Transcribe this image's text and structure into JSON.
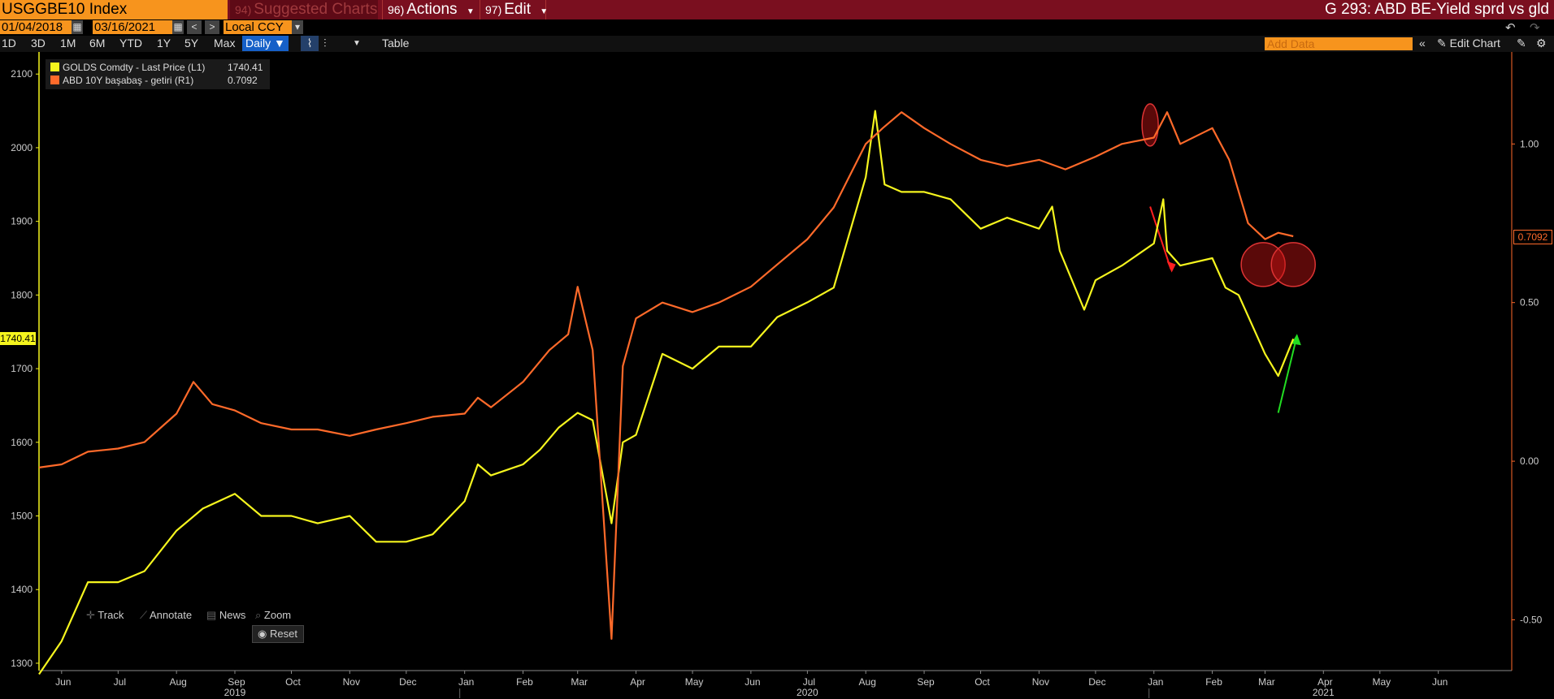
{
  "header": {
    "ticker": "USGGBE10 Index",
    "suggested_num": "94)",
    "suggested_label": "Suggested Charts",
    "actions_num": "96)",
    "actions_label": "Actions",
    "edit_num": "97)",
    "edit_label": "Edit",
    "chart_name": "G 293: ABD BE-Yield sprd vs gld"
  },
  "date_range": {
    "start": "01/04/2018",
    "end": "03/16/2021",
    "currency": "Local CCY"
  },
  "range_buttons": [
    "1D",
    "3D",
    "1M",
    "6M",
    "YTD",
    "1Y",
    "5Y",
    "Max"
  ],
  "frequency": "Daily ▼",
  "table_label": "Table",
  "add_data_placeholder": "Add Data",
  "edit_chart_label": "Edit Chart",
  "legend": [
    {
      "name": "GOLDS Comdty - Last Price (L1)",
      "value": "1740.41",
      "color": "#f5f51e"
    },
    {
      "name": "ABD 10Y başabaş - getiri (R1)",
      "value": "0.7092",
      "color": "#ff6a2a"
    }
  ],
  "tools": {
    "track": "Track",
    "annotate": "Annotate",
    "news": "News",
    "zoom": "Zoom",
    "reset": "Reset"
  },
  "current_labels": {
    "left": "1740.41",
    "right": "0.7092"
  },
  "icons": [
    "calendar-icon",
    "prev-icon",
    "next-icon",
    "dropdown-icon",
    "line-chart-icon",
    "candle-icon",
    "undo-icon",
    "redo-icon",
    "collapse-icon",
    "pencil-icon",
    "settings-icon",
    "track-icon",
    "annotate-icon",
    "news-icon",
    "zoom-icon",
    "radio-icon"
  ],
  "chart_data": {
    "type": "line",
    "x_range": [
      "2019-05-20",
      "2021-07-10"
    ],
    "left_axis": {
      "ylim": [
        1290,
        2130
      ],
      "ticks": [
        1300,
        1400,
        1500,
        1600,
        1700,
        1800,
        1900,
        2000,
        2100
      ]
    },
    "right_axis": {
      "ylim": [
        -0.66,
        1.29
      ],
      "ticks": [
        -0.5,
        0.0,
        0.5,
        1.0
      ],
      "tick_labels": [
        "-0.50",
        "0.00",
        "0.50",
        "1.00"
      ]
    },
    "x_ticks": [
      "Jun",
      "Jul",
      "Aug",
      "Sep",
      "Oct",
      "Nov",
      "Dec",
      "Jan",
      "Feb",
      "Mar",
      "Apr",
      "May",
      "Jun",
      "Jul",
      "Aug",
      "Sep",
      "Oct",
      "Nov",
      "Dec",
      "Jan",
      "Feb",
      "Mar",
      "Apr",
      "May",
      "Jun"
    ],
    "x_tick_dates": [
      "2019-06-01",
      "2019-07-01",
      "2019-08-01",
      "2019-09-01",
      "2019-10-01",
      "2019-11-01",
      "2019-12-01",
      "2020-01-01",
      "2020-02-01",
      "2020-03-01",
      "2020-04-01",
      "2020-05-01",
      "2020-06-01",
      "2020-07-01",
      "2020-08-01",
      "2020-09-01",
      "2020-10-01",
      "2020-11-01",
      "2020-12-01",
      "2021-01-01",
      "2021-02-01",
      "2021-03-01",
      "2021-04-01",
      "2021-05-01",
      "2021-06-01"
    ],
    "year_labels": [
      {
        "label": "2019",
        "date": "2019-09-01"
      },
      {
        "label": "2020",
        "date": "2020-07-01"
      },
      {
        "label": "2021",
        "date": "2021-04-01"
      }
    ],
    "series": [
      {
        "name": "GOLDS Comdty - Last Price (L1)",
        "axis": "left",
        "color": "#f5f51e",
        "x": [
          "2019-05-20",
          "2019-06-01",
          "2019-06-15",
          "2019-07-01",
          "2019-07-15",
          "2019-08-01",
          "2019-08-15",
          "2019-09-01",
          "2019-09-15",
          "2019-10-01",
          "2019-10-15",
          "2019-11-01",
          "2019-11-15",
          "2019-12-01",
          "2019-12-15",
          "2020-01-01",
          "2020-01-08",
          "2020-01-15",
          "2020-02-01",
          "2020-02-10",
          "2020-02-20",
          "2020-03-01",
          "2020-03-09",
          "2020-03-19",
          "2020-03-25",
          "2020-04-01",
          "2020-04-15",
          "2020-05-01",
          "2020-05-15",
          "2020-06-01",
          "2020-06-15",
          "2020-07-01",
          "2020-07-15",
          "2020-08-01",
          "2020-08-06",
          "2020-08-11",
          "2020-08-20",
          "2020-09-01",
          "2020-09-15",
          "2020-10-01",
          "2020-10-15",
          "2020-11-01",
          "2020-11-08",
          "2020-11-12",
          "2020-11-25",
          "2020-12-01",
          "2020-12-15",
          "2021-01-01",
          "2021-01-06",
          "2021-01-08",
          "2021-01-15",
          "2021-02-01",
          "2021-02-08",
          "2021-02-15",
          "2021-03-01",
          "2021-03-08",
          "2021-03-16"
        ],
        "values": [
          1285,
          1330,
          1410,
          1410,
          1425,
          1480,
          1510,
          1530,
          1500,
          1500,
          1490,
          1500,
          1465,
          1465,
          1475,
          1520,
          1570,
          1555,
          1570,
          1590,
          1620,
          1640,
          1630,
          1490,
          1600,
          1610,
          1720,
          1700,
          1730,
          1730,
          1770,
          1790,
          1810,
          1960,
          2050,
          1950,
          1940,
          1940,
          1930,
          1890,
          1905,
          1890,
          1920,
          1860,
          1780,
          1820,
          1840,
          1870,
          1930,
          1860,
          1840,
          1850,
          1810,
          1800,
          1720,
          1690,
          1740.41
        ]
      },
      {
        "name": "ABD 10Y başabaş - getiri (R1)",
        "axis": "right",
        "color": "#ff6a2a",
        "x": [
          "2019-05-20",
          "2019-06-01",
          "2019-06-15",
          "2019-07-01",
          "2019-07-15",
          "2019-08-01",
          "2019-08-10",
          "2019-08-20",
          "2019-09-01",
          "2019-09-15",
          "2019-10-01",
          "2019-10-15",
          "2019-11-01",
          "2019-11-15",
          "2019-12-01",
          "2019-12-15",
          "2020-01-01",
          "2020-01-08",
          "2020-01-15",
          "2020-02-01",
          "2020-02-15",
          "2020-02-25",
          "2020-03-01",
          "2020-03-09",
          "2020-03-19",
          "2020-03-25",
          "2020-04-01",
          "2020-04-15",
          "2020-05-01",
          "2020-05-15",
          "2020-06-01",
          "2020-06-15",
          "2020-07-01",
          "2020-07-15",
          "2020-08-01",
          "2020-08-10",
          "2020-08-20",
          "2020-09-01",
          "2020-09-15",
          "2020-10-01",
          "2020-10-15",
          "2020-11-01",
          "2020-11-15",
          "2020-12-01",
          "2020-12-15",
          "2021-01-01",
          "2021-01-08",
          "2021-01-15",
          "2021-02-01",
          "2021-02-10",
          "2021-02-20",
          "2021-03-01",
          "2021-03-08",
          "2021-03-16"
        ],
        "values": [
          -0.02,
          -0.01,
          0.03,
          0.04,
          0.06,
          0.15,
          0.25,
          0.18,
          0.16,
          0.12,
          0.1,
          0.1,
          0.08,
          0.1,
          0.12,
          0.14,
          0.15,
          0.2,
          0.17,
          0.25,
          0.35,
          0.4,
          0.55,
          0.35,
          -0.56,
          0.3,
          0.45,
          0.5,
          0.47,
          0.5,
          0.55,
          0.62,
          0.7,
          0.8,
          1.0,
          1.05,
          1.1,
          1.05,
          1.0,
          0.95,
          0.93,
          0.95,
          0.92,
          0.96,
          1.0,
          1.02,
          1.1,
          1.0,
          1.05,
          0.95,
          0.75,
          0.7,
          0.72,
          0.7092
        ]
      }
    ]
  }
}
